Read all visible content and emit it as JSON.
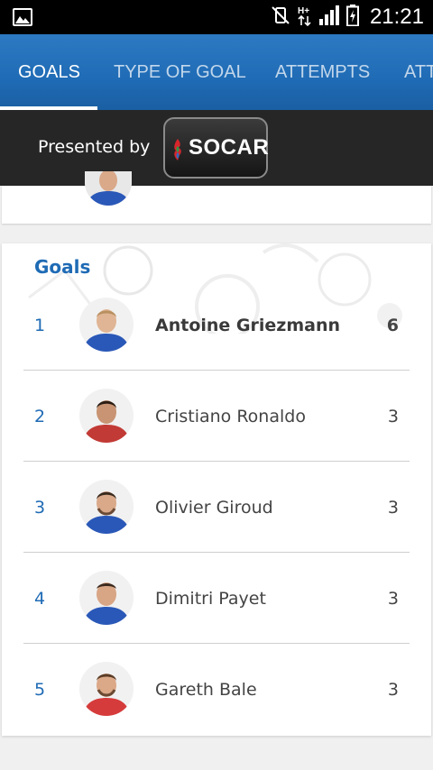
{
  "status_bar": {
    "time": "21:21",
    "icons": [
      "image-icon",
      "vibrate-off-icon",
      "hplus-data-icon",
      "signal-icon",
      "battery-charging-icon"
    ]
  },
  "tabs": [
    {
      "label": "GOALS",
      "active": true
    },
    {
      "label": "TYPE OF GOAL",
      "active": false
    },
    {
      "label": "ATTEMPTS",
      "active": false
    },
    {
      "label": "ATT",
      "active": false
    }
  ],
  "sponsor": {
    "presented_by": "Presented by",
    "brand": "SOCAR"
  },
  "goals": {
    "title": "Goals",
    "rows": [
      {
        "rank": "1",
        "name": "Antoine Griezmann",
        "value": "6",
        "kit": "#2a58b8"
      },
      {
        "rank": "2",
        "name": "Cristiano Ronaldo",
        "value": "3",
        "kit": "#c23a35"
      },
      {
        "rank": "3",
        "name": "Olivier Giroud",
        "value": "3",
        "kit": "#2a58b8"
      },
      {
        "rank": "4",
        "name": "Dimitri Payet",
        "value": "3",
        "kit": "#2a58b8"
      },
      {
        "rank": "5",
        "name": "Gareth Bale",
        "value": "3",
        "kit": "#d63b3b"
      }
    ]
  },
  "colors": {
    "accent": "#1f6bb5",
    "tabbar": "#2570bb",
    "sponsor_bg": "#262626"
  }
}
